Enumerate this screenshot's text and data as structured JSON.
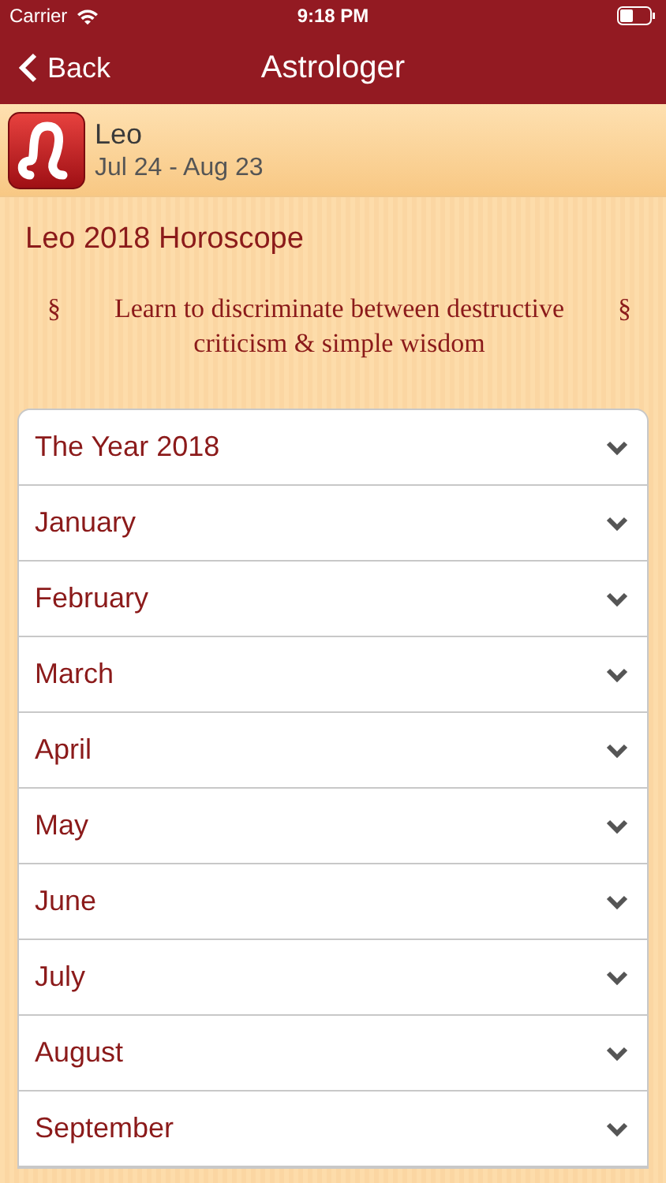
{
  "status_bar": {
    "carrier": "Carrier",
    "time": "9:18 PM"
  },
  "nav": {
    "back": "Back",
    "title": "Astrologer"
  },
  "sign": {
    "name": "Leo",
    "dates": "Jul 24 - Aug 23"
  },
  "heading": "Leo 2018 Horoscope",
  "quote": {
    "mark_left": "§",
    "text": "Learn to discriminate between destructive criticism & simple wisdom",
    "mark_right": "§"
  },
  "sections": [
    {
      "label": "The Year 2018"
    },
    {
      "label": "January"
    },
    {
      "label": "February"
    },
    {
      "label": "March"
    },
    {
      "label": "April"
    },
    {
      "label": "May"
    },
    {
      "label": "June"
    },
    {
      "label": "July"
    },
    {
      "label": "August"
    },
    {
      "label": "September"
    }
  ]
}
